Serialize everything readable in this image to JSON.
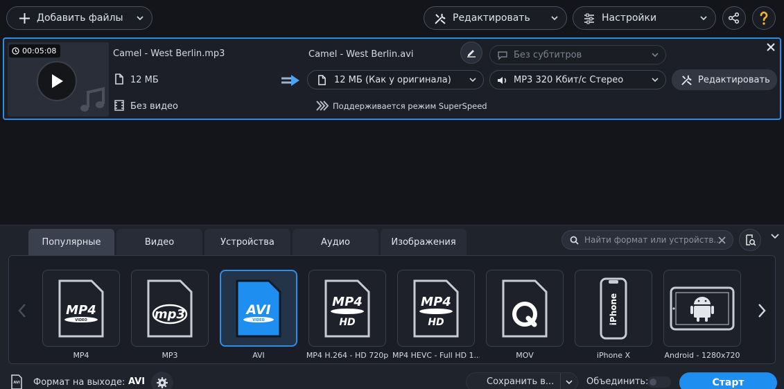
{
  "toolbar": {
    "add_files_label": "Добавить файлы",
    "edit_label": "Редактировать",
    "settings_label": "Настройки"
  },
  "file": {
    "duration": "00:05:08",
    "source_name": "Camel - West Berlin.mp3",
    "source_size": "12 МБ",
    "video_info": "Без видео",
    "output_name": "Camel - West Berlin.avi",
    "subtitles": "Без субтитров",
    "output_size": "12 МБ (Как у оригинала)",
    "audio_track": "MP3 320 Кбит/с Стерео",
    "edit_label": "Редактировать",
    "superspeed_note": "Поддерживается режим SuperSpeed"
  },
  "tabs": [
    {
      "label": "Популярные",
      "active": true
    },
    {
      "label": "Видео",
      "active": false
    },
    {
      "label": "Устройства",
      "active": false
    },
    {
      "label": "Аудио",
      "active": false
    },
    {
      "label": "Изображения",
      "active": false
    }
  ],
  "search": {
    "placeholder": "Найти формат или устройств..."
  },
  "formats": [
    {
      "label": "MP4",
      "badge": "MP4",
      "sub": "VIDEO",
      "icon": "mp4-file-icon",
      "selected": false
    },
    {
      "label": "MP3",
      "badge": "mp3",
      "sub": "",
      "icon": "mp3-file-icon",
      "selected": false
    },
    {
      "label": "AVI",
      "badge": "AVI",
      "sub": "VIDEO",
      "icon": "avi-file-icon",
      "selected": true
    },
    {
      "label": "MP4 H.264 - HD 720p",
      "badge": "MP4",
      "sub": "HD",
      "icon": "mp4-hd-file-icon",
      "selected": false
    },
    {
      "label": "MP4 HEVC - Full HD 1...",
      "badge": "MP4",
      "sub": "HD",
      "icon": "mp4-hevc-file-icon",
      "selected": false
    },
    {
      "label": "MOV",
      "badge": "",
      "sub": "",
      "icon": "quicktime-icon",
      "selected": false
    },
    {
      "label": "iPhone X",
      "badge": "iPhone",
      "sub": "",
      "icon": "iphone-icon",
      "selected": false
    },
    {
      "label": "Android - 1280x720",
      "badge": "",
      "sub": "",
      "icon": "android-tablet-icon",
      "selected": false
    }
  ],
  "bottom": {
    "output_format_label": "Формат на выходе:",
    "output_format_value": "AVI",
    "save_label": "Сохранить в...",
    "merge_label": "Объединить:",
    "start_label": "Старт"
  },
  "colors": {
    "accent": "#2d8ee8",
    "start": "#1e8ef0"
  }
}
